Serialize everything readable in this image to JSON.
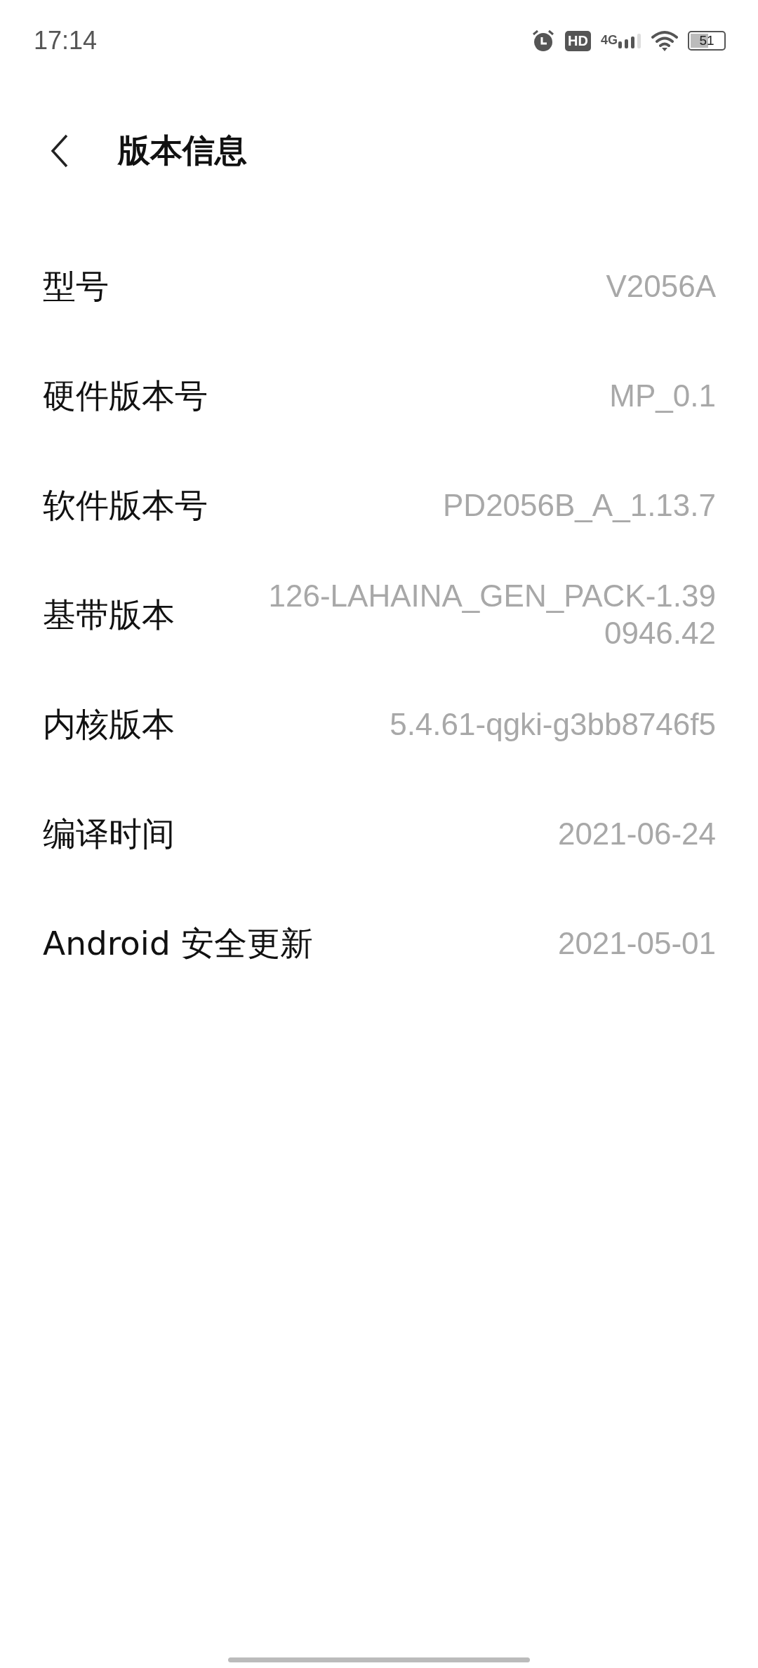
{
  "status_bar": {
    "time": "17:14",
    "network": "4G",
    "hd": "HD",
    "battery": "51"
  },
  "header": {
    "title": "版本信息"
  },
  "rows": [
    {
      "label": "型号",
      "value": "V2056A"
    },
    {
      "label": "硬件版本号",
      "value": "MP_0.1"
    },
    {
      "label": "软件版本号",
      "value": "PD2056B_A_1.13.7"
    },
    {
      "label": "基带版本",
      "value": "126-LAHAINA_GEN_PACK-1.390946.42"
    },
    {
      "label": "内核版本",
      "value": "5.4.61-qgki-g3bb8746f5"
    },
    {
      "label": "编译时间",
      "value": "2021-06-24"
    },
    {
      "label": "Android 安全更新",
      "value": "2021-05-01"
    }
  ]
}
